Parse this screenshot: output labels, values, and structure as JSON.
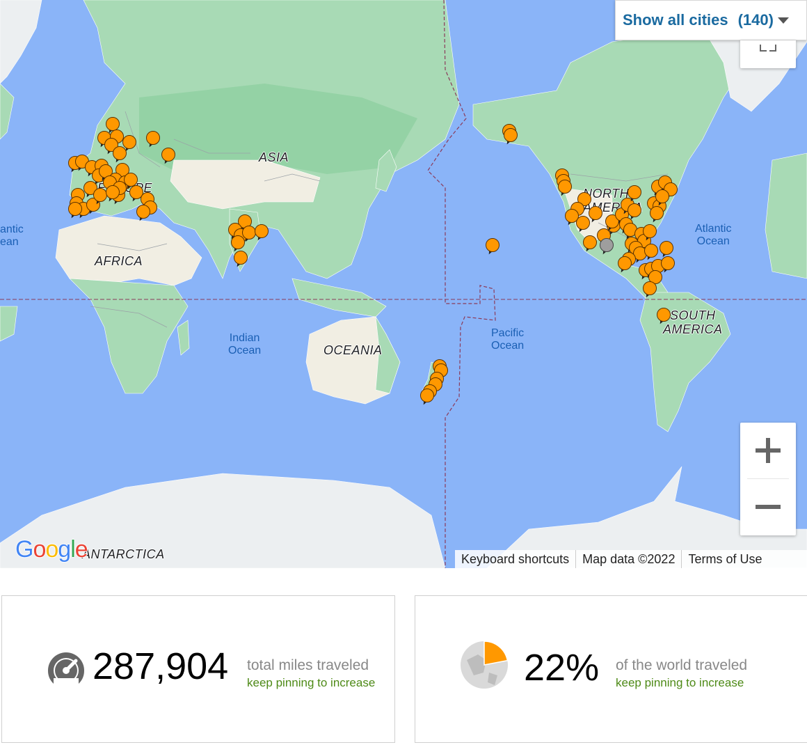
{
  "map": {
    "continent_labels": [
      "ASIA",
      "EUROPE",
      "AFRICA",
      "OCEANIA",
      "NORTH\nAMERICA",
      "SOUTH\nAMERICA",
      "ANTARCTICA"
    ],
    "ocean_labels": {
      "atlantic_left": "antic\nean",
      "indian": "Indian\nOcean",
      "pacific": "Pacific\nOcean",
      "atlantic_right": "Atlantic\nOcean"
    },
    "city_filter": {
      "label": "Show all cities",
      "count": "(140)"
    },
    "attribution": {
      "keyboard": "Keyboard shortcuts",
      "map_data": "Map data ©2022",
      "terms": "Terms of Use"
    },
    "logo": "Google",
    "colors": {
      "pin": "#ff9800",
      "pin_inactive": "#9e9e9e",
      "water": "#8ab4f8",
      "land": "#a8dab5"
    }
  },
  "stats": {
    "miles": {
      "value": "287,904",
      "label": "total miles traveled",
      "sub": "keep pinning to increase"
    },
    "world": {
      "value": "22%",
      "label": "of the world traveled",
      "sub": "keep pinning to increase",
      "fraction": 0.22
    }
  }
}
